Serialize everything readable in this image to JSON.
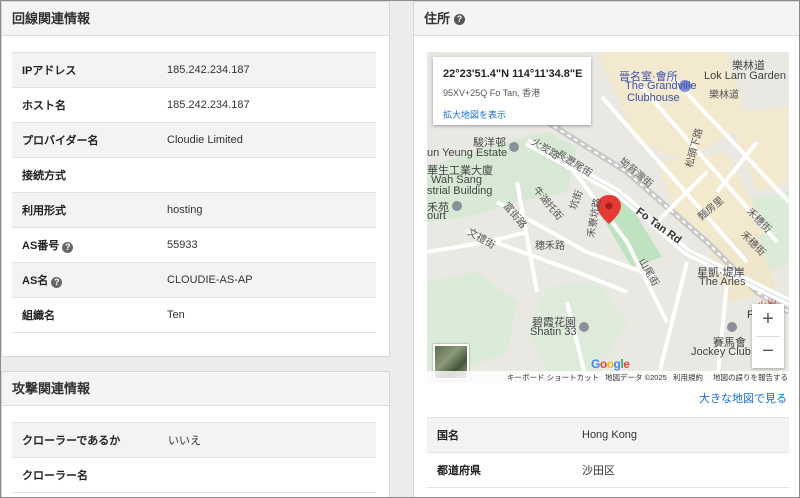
{
  "line_panel": {
    "title": "回線関連情報",
    "rows": [
      {
        "key": "IPアドレス",
        "value": "185.242.234.187"
      },
      {
        "key": "ホスト名",
        "value": "185.242.234.187"
      },
      {
        "key": "プロバイダー名",
        "value": "Cloudie Limited"
      },
      {
        "key": "接続方式",
        "value": ""
      },
      {
        "key": "利用形式",
        "value": "hosting"
      },
      {
        "key": "AS番号",
        "value": "55933"
      },
      {
        "key": "AS名",
        "value": "CLOUDIE-AS-AP"
      },
      {
        "key": "組織名",
        "value": "Ten"
      }
    ]
  },
  "attack_panel": {
    "title": "攻撃関連情報",
    "rows": [
      {
        "key": "クローラーであるか",
        "value": "いいえ"
      },
      {
        "key": "クローラー名",
        "value": ""
      }
    ]
  },
  "address_panel": {
    "title": "住所",
    "map": {
      "coords": "22°23'51.4\"N 114°11'34.8\"E",
      "plus_code": "95XV+25Q Fo Tan, 香港",
      "enlarge_link": "拡大地図を表示",
      "labels": {
        "l1": "晉名室·會所",
        "l2": "The Grandville",
        "l3": "Clubhouse",
        "l4": "樂林道",
        "l5": "Lok Lam Garden",
        "l6": "樂林道",
        "l7": "駿洋邨",
        "l8": "un Yeung Estate",
        "l9": "華生工業大廈",
        "l10": "Wah Sang",
        "l11": "strial Building",
        "l12": "禾苑",
        "l13": "ourt",
        "l14": "火炭路",
        "l15": "長瀝尾街",
        "l16": "坳背灣街",
        "l17": "牛湖托街",
        "l18": "富街路",
        "l19": "坑街",
        "l20": "禾寮坑路",
        "l21": "穗禾路",
        "l22": "文禮街",
        "l23": "Fo Tan Rd",
        "l24": "麵房里",
        "l25": "禾穗街",
        "l26": "禾穗街",
        "l27": "山尾街",
        "l28": "星凱·堤岸",
        "l29": "The Arles",
        "l30": "碧霞花園",
        "l31": "Shatin 33",
        "l32": "賽馬會",
        "l33": "Jockey Club T",
        "l34": "松頭下路",
        "l35": "火炭",
        "l36": "Fo"
      },
      "zoom_in": "+",
      "zoom_out": "−",
      "google_letters": [
        "G",
        "o",
        "o",
        "g",
        "l",
        "e"
      ],
      "attribution": {
        "shortcuts": "キーボード ショートカット",
        "map_data": "地図データ ©2025",
        "terms": "利用規約",
        "report": "地図の誤りを報告する"
      }
    },
    "larger_map_link": "大きな地図で見る",
    "rows": [
      {
        "key": "国名",
        "value": "Hong Kong"
      },
      {
        "key": "都道府県",
        "value": "沙田区"
      }
    ]
  },
  "colors": {
    "link": "#1a6dd6",
    "pin": "#e53935",
    "google": [
      "#4285f4",
      "#ea4335",
      "#fbbc05",
      "#4285f4",
      "#34a853",
      "#ea4335"
    ]
  },
  "icons": {
    "help": "question-circle-icon",
    "pin": "map-pin-icon",
    "poi": "place-marker-icon"
  }
}
